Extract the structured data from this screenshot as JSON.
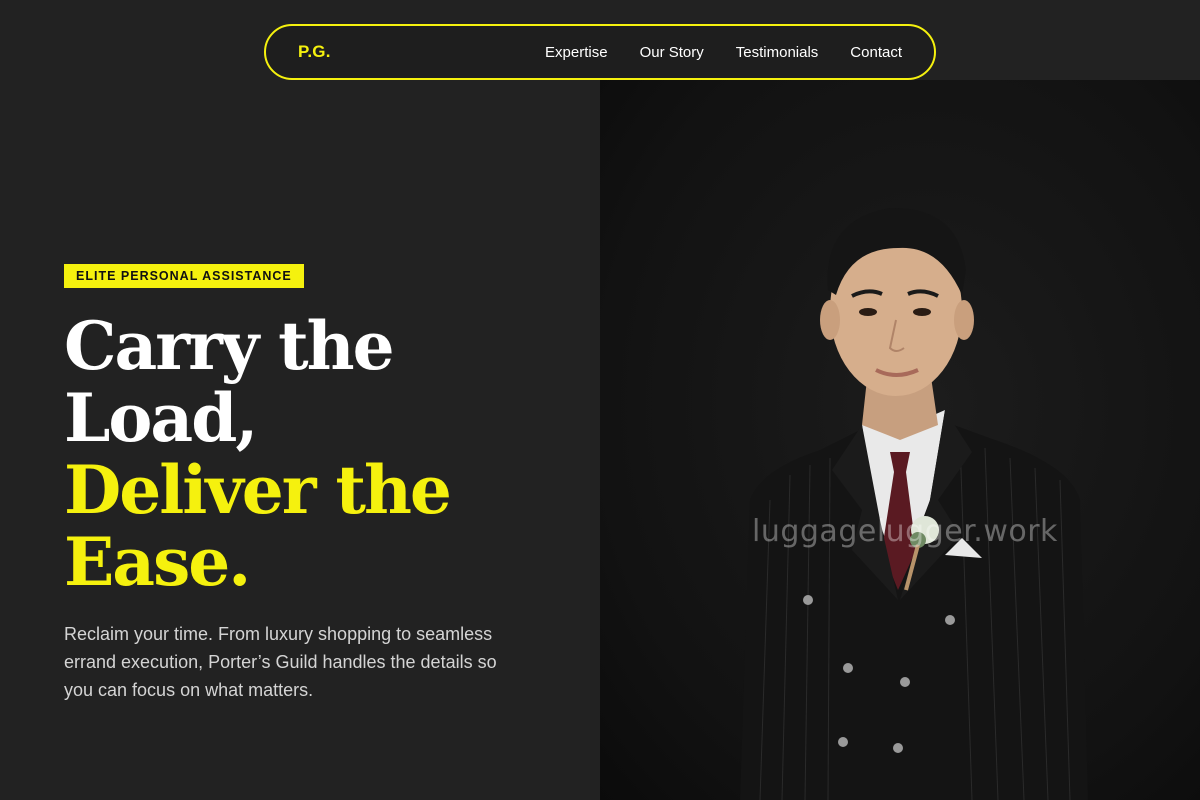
{
  "nav": {
    "logo": "P.G.",
    "links": [
      {
        "label": "Expertise"
      },
      {
        "label": "Our Story"
      },
      {
        "label": "Testimonials"
      },
      {
        "label": "Contact"
      }
    ]
  },
  "hero": {
    "badge": "ELITE PERSONAL ASSISTANCE",
    "headline_white": [
      "Carry the",
      "Load,"
    ],
    "headline_yellow": [
      "Deliver the",
      "Ease."
    ],
    "lede": "Reclaim your time. From luxury shopping to seamless errand execution, Porter’s Guild handles the details so you can focus on what matters."
  },
  "photo": {
    "watermark": "luggagelugger.work",
    "subject": "man in double-breasted pinstripe suit with boutonniere"
  },
  "colors": {
    "accent": "#f5f10e",
    "background": "#222222",
    "text": "#ffffff",
    "muted_text": "#d4d4d4"
  }
}
